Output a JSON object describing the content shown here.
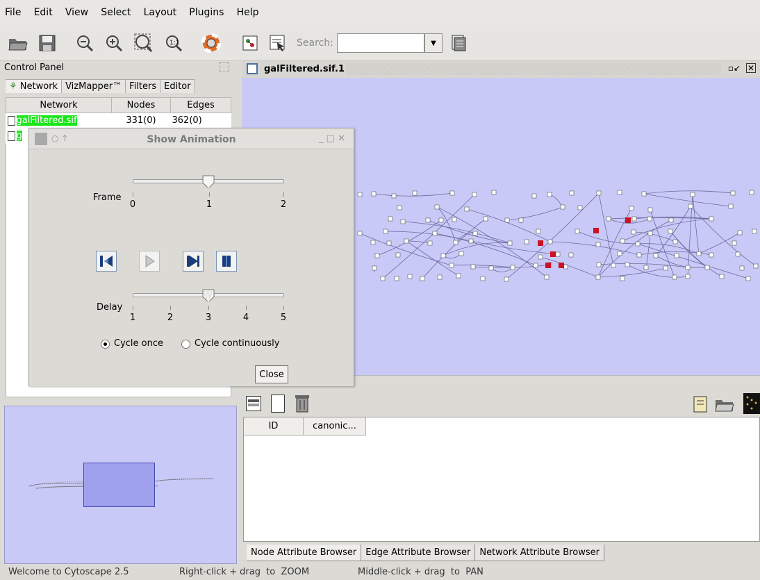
{
  "menubar": {
    "items": [
      "File",
      "Edit",
      "View",
      "Select",
      "Layout",
      "Plugins",
      "Help"
    ]
  },
  "toolbar": {
    "search_label": "Search:",
    "search_value": "",
    "icons": [
      "open-folder-icon",
      "save-icon",
      "zoom-out-icon",
      "zoom-in-icon",
      "zoom-fit-icon",
      "zoom-selected-icon",
      "help-lifebuoy-icon",
      "layout-icon",
      "select-icon",
      "search-options-icon"
    ]
  },
  "control_panel": {
    "title": "Control Panel",
    "tabs": [
      "Network",
      "VizMapper™",
      "Filters",
      "Editor"
    ],
    "table": {
      "headers": [
        "Network",
        "Nodes",
        "Edges"
      ],
      "rows": [
        {
          "name": "galFiltered.sif",
          "nodes": "331(0)",
          "edges": "362(0)"
        },
        {
          "name": "g",
          "nodes": "",
          "edges": ""
        }
      ]
    }
  },
  "network_view": {
    "title": "galFiltered.sif.1",
    "background": "#c9c9f7",
    "highlight_color": "#cc1122"
  },
  "attribute_browser": {
    "columns": [
      "ID",
      "canonic..."
    ],
    "tabs": [
      "Node Attribute Browser",
      "Edge Attribute Browser",
      "Network Attribute Browser"
    ]
  },
  "dialog": {
    "title": "Show Animation",
    "frame_label": "Frame",
    "frame_ticks": [
      "0",
      "1",
      "2"
    ],
    "frame_value": 1,
    "delay_label": "Delay",
    "delay_ticks": [
      "1",
      "2",
      "3",
      "4",
      "5"
    ],
    "delay_value": 3,
    "radio_once": "Cycle once",
    "radio_continuous": "Cycle continuously",
    "close_label": "Close"
  },
  "statusbar": {
    "message": "Welcome to Cytoscape 2.5",
    "zoom_hint": "Right-click + drag  to  ZOOM",
    "pan_hint": "Middle-click + drag  to  PAN"
  }
}
